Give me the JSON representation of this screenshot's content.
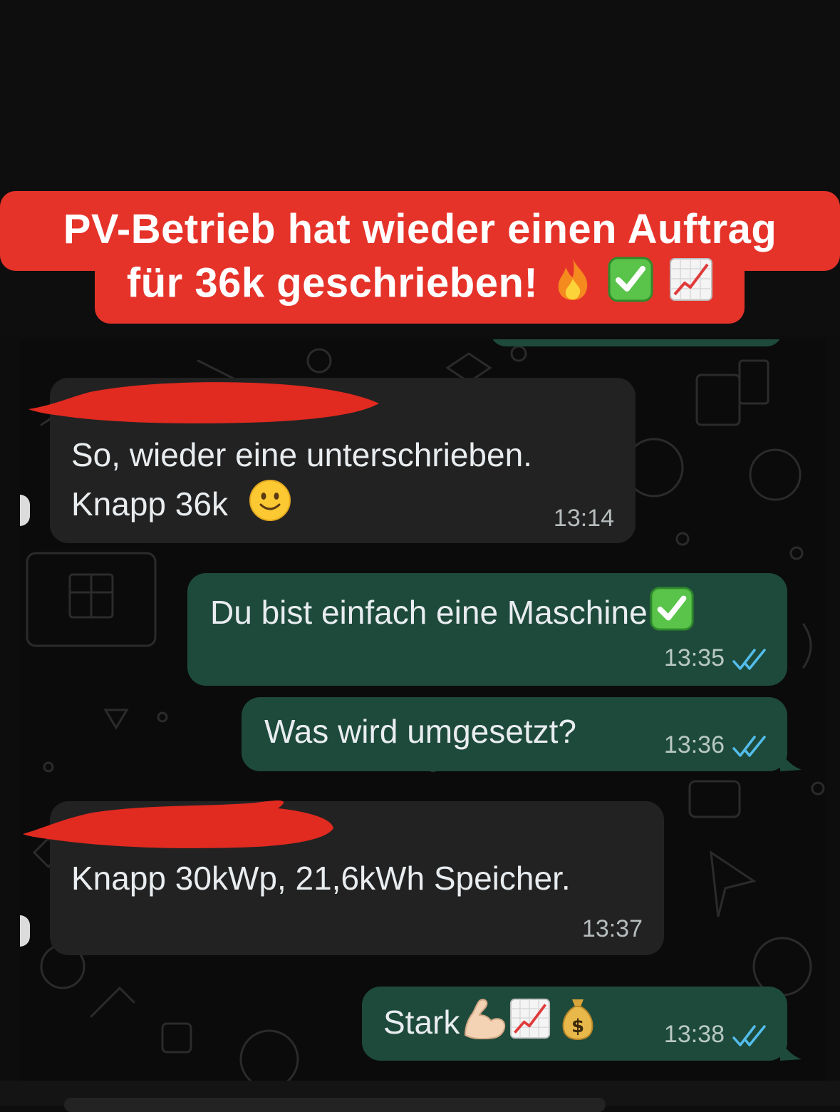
{
  "caption": {
    "line1": "PV-Betrieb hat wieder einen Auftrag",
    "line2": "für 36k geschrieben!",
    "line2_icons": [
      "fire-icon",
      "check-box-icon",
      "chart-up-icon"
    ]
  },
  "messages": [
    {
      "id": "m1",
      "direction": "incoming",
      "sender_redacted": true,
      "line1": "So, wieder eine unterschrieben.",
      "line2": "Knapp 36k",
      "icons": [
        "smiley-icon"
      ],
      "time": "13:14"
    },
    {
      "id": "m2",
      "direction": "outgoing",
      "text": "Du bist einfach eine Maschine",
      "icons": [
        "check-box-icon"
      ],
      "time": "13:35",
      "status": "read"
    },
    {
      "id": "m3",
      "direction": "outgoing",
      "text": "Was wird umgesetzt?",
      "time": "13:36",
      "status": "read"
    },
    {
      "id": "m4",
      "direction": "incoming",
      "sender_redacted": true,
      "text": "Knapp 30kWp, 21,6kWh Speicher.",
      "time": "13:37"
    },
    {
      "id": "m5",
      "direction": "outgoing",
      "text": "Stark",
      "icons": [
        "flexed-biceps-icon",
        "chart-up-icon",
        "money-bag-icon"
      ],
      "time": "13:38",
      "status": "read"
    }
  ],
  "colors": {
    "banner": "#e5332a",
    "incoming_bubble": "#222222",
    "outgoing_bubble": "#1e4a3b",
    "read_ticks": "#53bdeb"
  }
}
